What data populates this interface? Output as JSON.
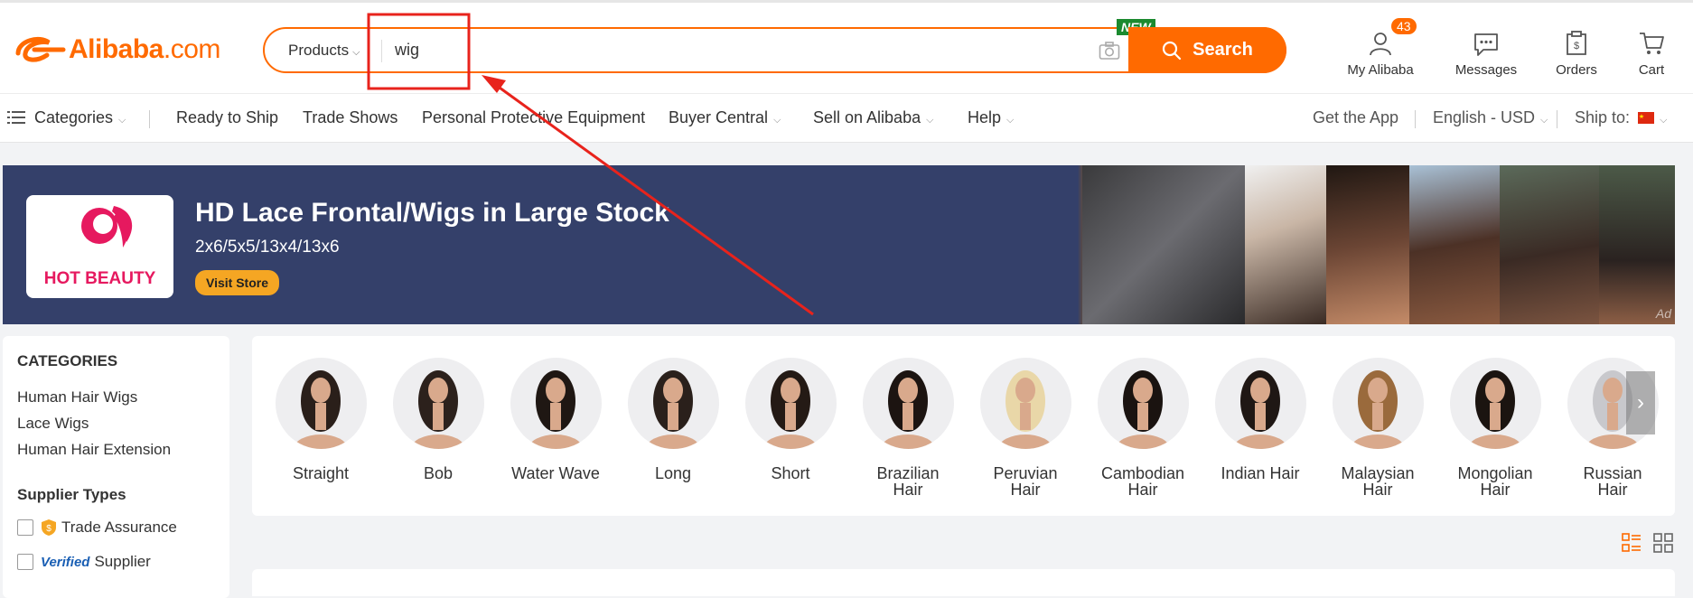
{
  "header": {
    "logo_text": "Alibaba",
    "logo_suffix": ".com",
    "search_category": "Products",
    "search_query": "wig",
    "new_badge": "NEW",
    "search_button": "Search",
    "my_alibaba": "My Alibaba",
    "my_alibaba_count": "43",
    "messages": "Messages",
    "orders": "Orders",
    "cart": "Cart"
  },
  "nav": {
    "categories": "Categories",
    "items": [
      "Ready to Ship",
      "Trade Shows",
      "Personal Protective Equipment",
      "Buyer Central",
      "Sell on Alibaba",
      "Help"
    ],
    "get_app": "Get the App",
    "language": "English - USD",
    "ship_to": "Ship to:"
  },
  "banner": {
    "brand": "HOT BEAUTY",
    "title": "HD Lace Frontal/Wigs in Large Stock",
    "subtitle": "2x6/5x5/13x4/13x6",
    "cta": "Visit Store",
    "ad_tag": "Ad"
  },
  "sidebar": {
    "categories_heading": "CATEGORIES",
    "categories": [
      "Human Hair Wigs",
      "Lace Wigs",
      "Human Hair Extension"
    ],
    "supplier_heading": "Supplier Types",
    "trade_assurance": "Trade Assurance",
    "verified_tag": "Verified",
    "supplier": "Supplier"
  },
  "wig_categories": [
    {
      "line1": "Straight",
      "line2": ""
    },
    {
      "line1": "Bob",
      "line2": ""
    },
    {
      "line1": "Water Wave",
      "line2": ""
    },
    {
      "line1": "Long",
      "line2": ""
    },
    {
      "line1": "Short",
      "line2": ""
    },
    {
      "line1": "Brazilian",
      "line2": "Hair"
    },
    {
      "line1": "Peruvian",
      "line2": "Hair"
    },
    {
      "line1": "Cambodian",
      "line2": "Hair"
    },
    {
      "line1": "Indian Hair",
      "line2": ""
    },
    {
      "line1": "Malaysian",
      "line2": "Hair"
    },
    {
      "line1": "Mongolian",
      "line2": "Hair"
    },
    {
      "line1": "Russian",
      "line2": "Hair"
    }
  ],
  "colors": {
    "accent": "#ff6a00",
    "banner_bg": "#34406a",
    "annotation": "#e8231c"
  }
}
